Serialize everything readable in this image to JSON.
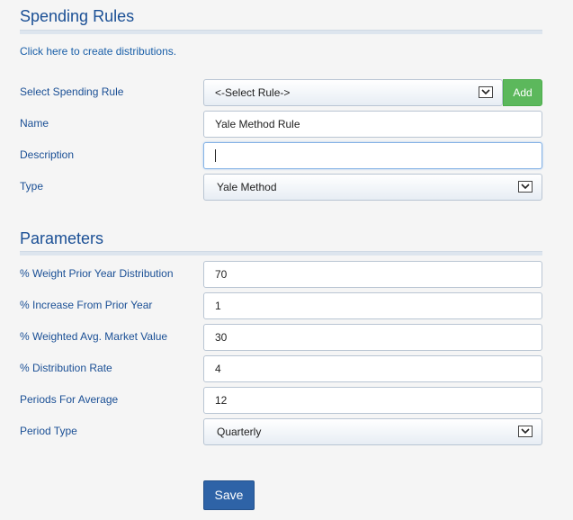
{
  "spending_rules": {
    "title": "Spending Rules",
    "create_link": "Click here to create distributions.",
    "select_rule": {
      "label": "Select Spending Rule",
      "value": "<-Select Rule->",
      "add_label": "Add"
    },
    "name": {
      "label": "Name",
      "value": "Yale Method Rule"
    },
    "description": {
      "label": "Description",
      "value": ""
    },
    "type": {
      "label": "Type",
      "value": "Yale Method"
    }
  },
  "parameters": {
    "title": "Parameters",
    "weight_prior_year": {
      "label": "% Weight Prior Year Distribution",
      "value": "70"
    },
    "increase_prior_year": {
      "label": "% Increase From Prior Year",
      "value": "1"
    },
    "weighted_market_value": {
      "label": "% Weighted Avg. Market Value",
      "value": "30"
    },
    "distribution_rate": {
      "label": "% Distribution Rate",
      "value": "4"
    },
    "periods_for_average": {
      "label": "Periods For Average",
      "value": "12"
    },
    "period_type": {
      "label": "Period Type",
      "value": "Quarterly"
    }
  },
  "actions": {
    "save_label": "Save"
  },
  "colors": {
    "heading": "#1a4f95",
    "link": "#1a5fa8",
    "add_button": "#5cb85c",
    "save_button": "#2e63a7"
  },
  "icons": {
    "dropdown": "chevron-down-icon"
  }
}
